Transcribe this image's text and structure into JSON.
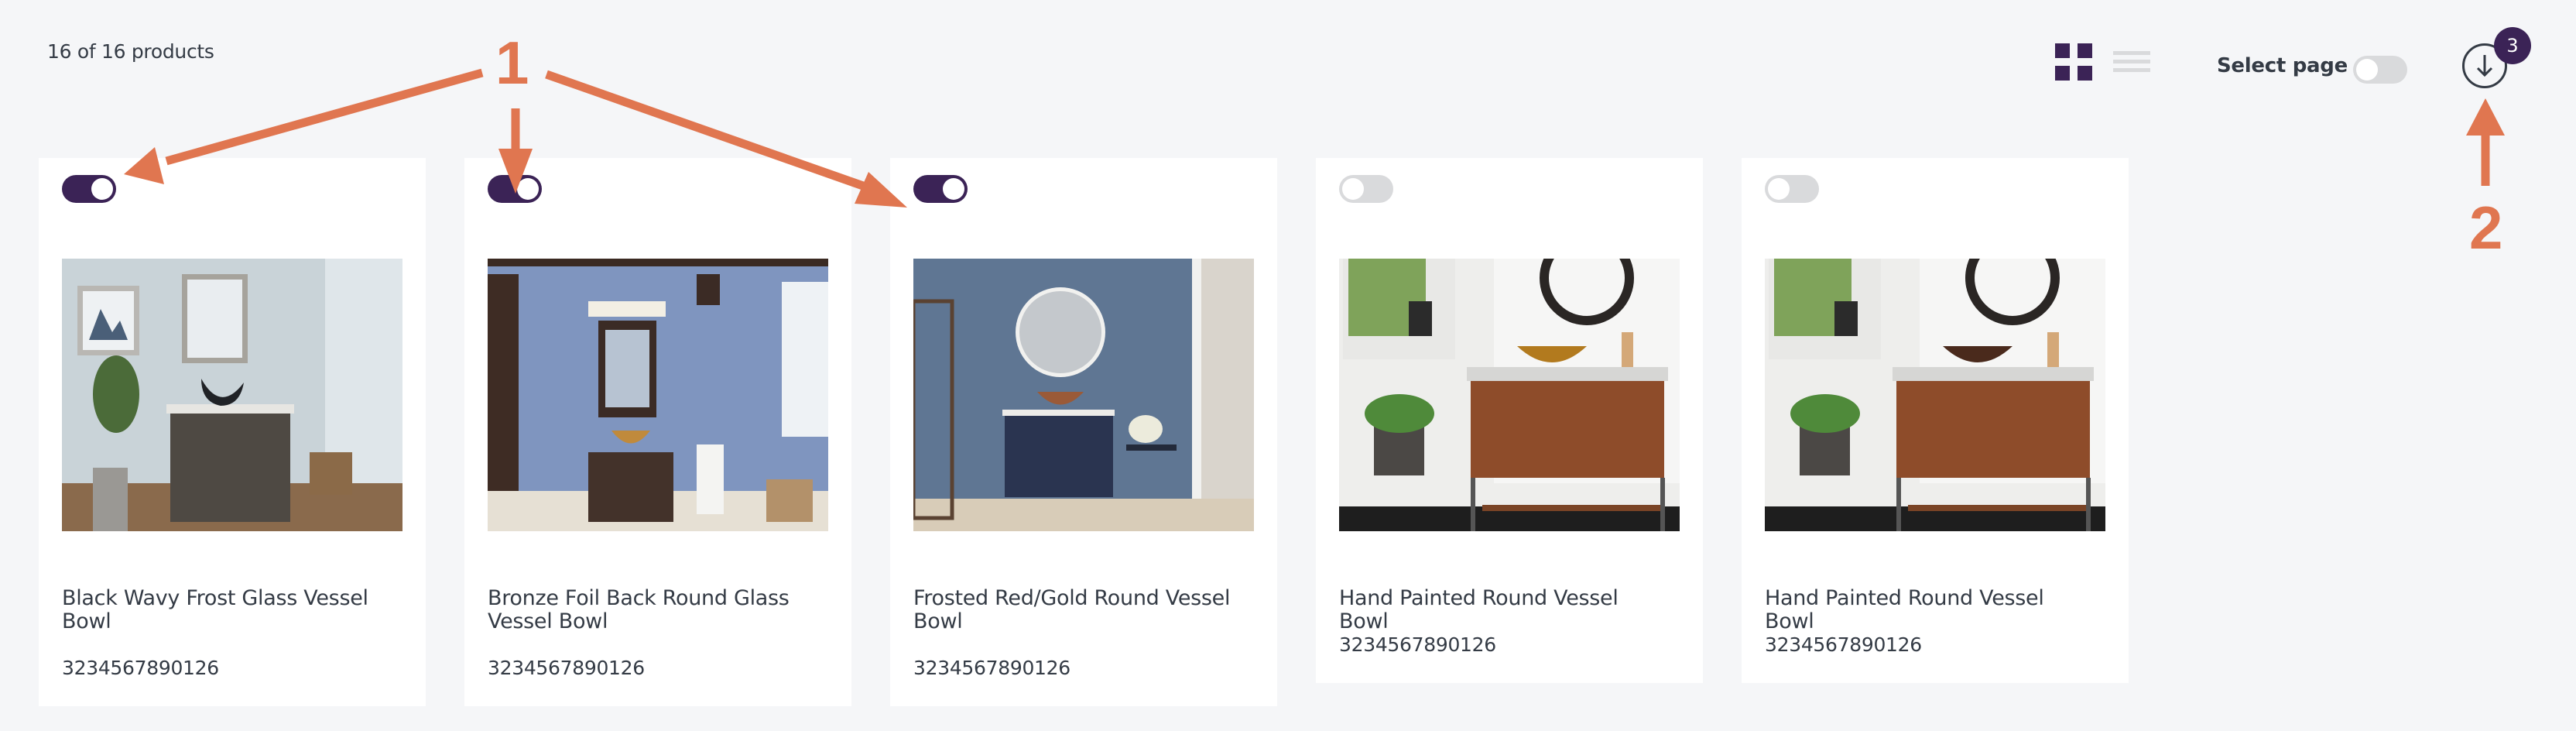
{
  "header": {
    "product_count": "16 of 16 products",
    "view_modes": [
      {
        "name": "grid",
        "icon": "grid-view-icon",
        "active": true
      },
      {
        "name": "list",
        "icon": "list-view-icon",
        "active": false
      }
    ],
    "select_page_label": "Select page",
    "select_page_on": false,
    "download_badge_count": "3",
    "download_icon": "download-arrow-icon"
  },
  "colors": {
    "accent": "#3b2356",
    "toggle_off": "#d9dadc",
    "text": "#343b45",
    "background": "#f5f6f8",
    "annotation": "#e07650"
  },
  "products": [
    {
      "title": "Black Wavy Frost Glass Vessel Bowl",
      "sku": "3234567890126",
      "selected": true,
      "scene": "gray-vanity"
    },
    {
      "title": "Bronze Foil Back Round Glass Vessel Bowl",
      "sku": "3234567890126",
      "selected": true,
      "scene": "blue-bathroom"
    },
    {
      "title": "Frosted Red/Gold Round Vessel Bowl",
      "sku": "3234567890126",
      "selected": true,
      "scene": "navy-vanity"
    },
    {
      "title": "Hand Painted Round Vessel Bowl",
      "sku": "3234567890126",
      "selected": false,
      "scene": "wood-vanity-gold"
    },
    {
      "title": "Hand Painted Round Vessel Bowl",
      "sku": "3234567890126",
      "selected": false,
      "scene": "wood-vanity-brown"
    }
  ],
  "annotations": {
    "label_1": "1",
    "label_2": "2"
  }
}
